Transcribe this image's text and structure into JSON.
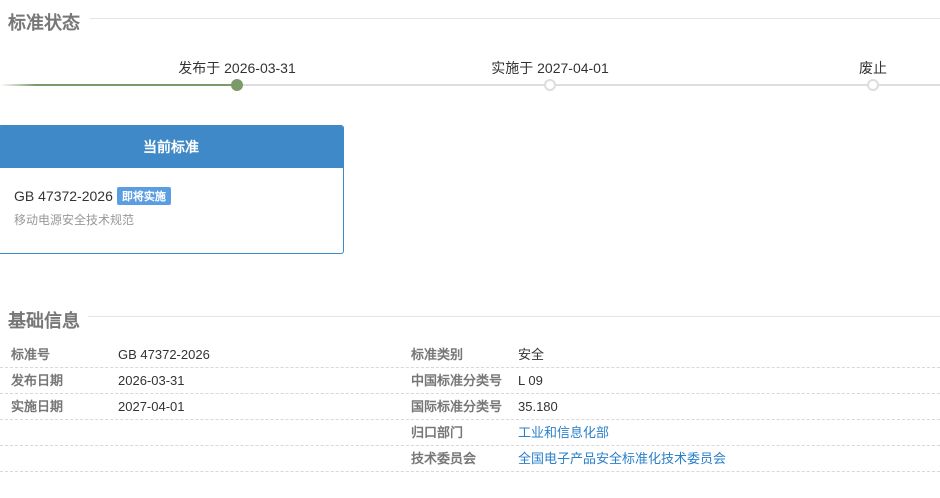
{
  "status_section": {
    "title": "标准状态"
  },
  "timeline": [
    {
      "label": "发布于 2026-03-31",
      "done": true
    },
    {
      "label": "实施于 2027-04-01",
      "done": false
    },
    {
      "label": "废止",
      "done": false
    }
  ],
  "card": {
    "header": "当前标准",
    "code": "GB 47372-2026",
    "badge": "即将实施",
    "name": "移动电源安全技术规范"
  },
  "info_section": {
    "title": "基础信息"
  },
  "info": {
    "rows": [
      {
        "l1": "标准号",
        "v1": "GB 47372-2026",
        "l2": "标准类别",
        "v2": "安全"
      },
      {
        "l1": "发布日期",
        "v1": "2026-03-31",
        "l2": "中国标准分类号",
        "v2": "L 09"
      },
      {
        "l1": "实施日期",
        "v1": "2027-04-01",
        "l2": "国际标准分类号",
        "v2": "35.180"
      },
      {
        "l1": "",
        "v1": "",
        "l2": "归口部门",
        "v2": "工业和信息化部"
      },
      {
        "l1": "",
        "v1": "",
        "l2": "技术委员会",
        "v2": "全国电子产品安全标准化技术委员会"
      }
    ]
  }
}
